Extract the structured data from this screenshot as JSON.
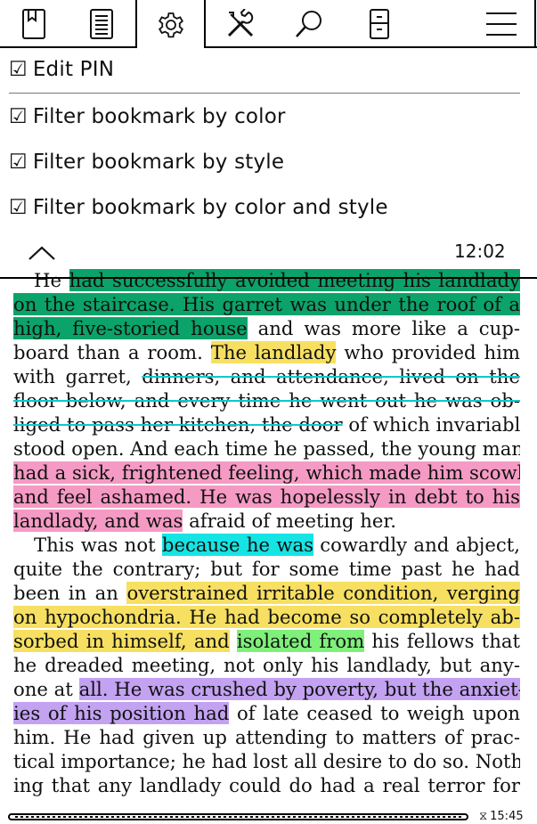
{
  "tabs": [
    {
      "name": "bookmark",
      "icon": "bookmark-icon"
    },
    {
      "name": "contents",
      "icon": "contents-icon"
    },
    {
      "name": "settings",
      "icon": "gear-icon",
      "active": true
    },
    {
      "name": "tools",
      "icon": "tools-icon"
    },
    {
      "name": "search",
      "icon": "search-icon"
    },
    {
      "name": "device",
      "icon": "device-icon"
    },
    {
      "name": "menu",
      "icon": "hamburger-icon"
    }
  ],
  "menu": {
    "items": [
      {
        "check": "☑",
        "label": "Edit PIN"
      },
      {
        "check": "☑",
        "label": "Filter bookmark by color"
      },
      {
        "check": "☑",
        "label": "Filter bookmark by style"
      },
      {
        "check": "☑",
        "label": "Filter bookmark by color and style"
      }
    ],
    "clock": "12:02"
  },
  "reader": {
    "lines": [
      [
        {
          "t": "He ",
          "indent": true
        },
        {
          "t": "had successfully avoided meeting his landlady",
          "hl": "green"
        }
      ],
      [
        {
          "t": "on the staircase. His garret was under the roof of a",
          "hl": "green"
        }
      ],
      [
        {
          "t": "high, five-storied house",
          "hl": "green"
        },
        {
          "t": " and was more like a cup-"
        }
      ],
      [
        {
          "t": "board than a room. "
        },
        {
          "t": "The landlady",
          "hl": "yellow"
        },
        {
          "t": " who provided him"
        }
      ],
      [
        {
          "t": "with garret, "
        },
        {
          "t": "dinners, and attendance, lived on the",
          "strike": true
        }
      ],
      [
        {
          "t": "floor below, and every time he went out he was ob-",
          "strike": true
        }
      ],
      [
        {
          "t": "liged to pass her kitchen, the door",
          "strike": true
        },
        {
          "t": " of which invariably"
        }
      ],
      [
        {
          "t": "stood open. And each time he passed, the young man"
        }
      ],
      [
        {
          "t": "had a sick, frightened feeling, which made him scowl",
          "hl": "pink"
        }
      ],
      [
        {
          "t": "and feel ashamed. He was hopelessly in debt to his",
          "hl": "pink"
        }
      ],
      [
        {
          "t": "landlady, and was",
          "hl": "pink"
        },
        {
          "t": " afraid of meeting her.",
          "last": true
        }
      ],
      [
        {
          "t": "This was not ",
          "indent": true
        },
        {
          "t": "because he was",
          "hl": "cyan"
        },
        {
          "t": " cowardly and abject,"
        }
      ],
      [
        {
          "t": "quite the contrary; but for some time past he had"
        }
      ],
      [
        {
          "t": "been in an "
        },
        {
          "t": "overstrained irritable condition, verging",
          "hl": "yellow"
        }
      ],
      [
        {
          "t": "on hypochondria. He had become so completely ab-",
          "hl": "yellow"
        }
      ],
      [
        {
          "t": "sorbed in himself, and",
          "hl": "yellow"
        },
        {
          "t": " "
        },
        {
          "t": "isolated from",
          "hl": "lime"
        },
        {
          "t": " his fellows that"
        }
      ],
      [
        {
          "t": "he dreaded meeting, not only his landlady, but any-"
        }
      ],
      [
        {
          "t": "one at "
        },
        {
          "t": "all. He was crushed by poverty, but the anxiet-",
          "hl": "purple"
        }
      ],
      [
        {
          "t": "ies of his position had",
          "hl": "purple"
        },
        {
          "t": " of late ceased to weigh upon"
        }
      ],
      [
        {
          "t": "him. He had given up attending to matters of prac-"
        }
      ],
      [
        {
          "t": "tical importance; he had lost all desire to do so. Noth-"
        }
      ],
      [
        {
          "t": "ing that any landlady could do had a real terror for"
        }
      ]
    ]
  },
  "status": {
    "clock": "15:45",
    "hourglass": "⧖"
  }
}
